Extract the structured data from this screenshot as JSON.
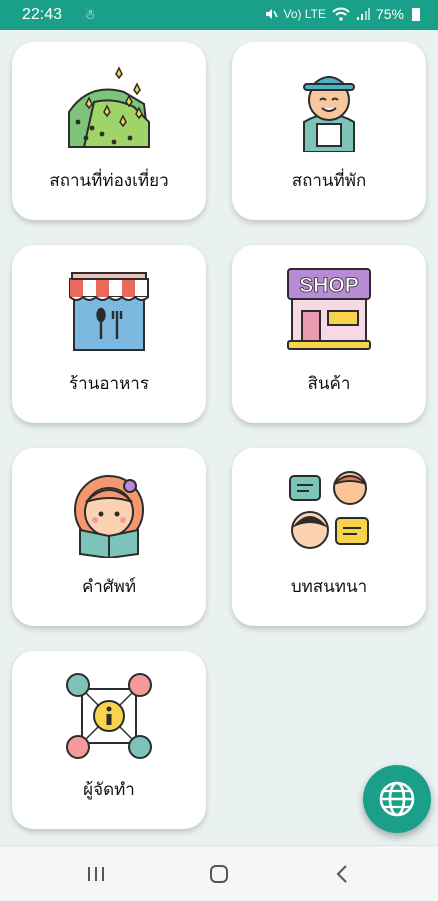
{
  "status_bar": {
    "time": "22:43",
    "notification": "☃",
    "battery_percent": "75%",
    "icons": [
      "mute-icon",
      "volte-icon",
      "wifi-icon",
      "signal-icon",
      "battery-icon"
    ],
    "volte": "Vo) LTE"
  },
  "menu": {
    "items": [
      {
        "label": "สถานที่ท่องเที่ยว",
        "icon": "tulip-field-icon"
      },
      {
        "label": "สถานที่พัก",
        "icon": "traveler-icon"
      },
      {
        "label": "ร้านอาหาร",
        "icon": "restaurant-icon"
      },
      {
        "label": "สินค้า",
        "icon": "shop-icon"
      },
      {
        "label": "คำศัพท์",
        "icon": "girl-reading-icon"
      },
      {
        "label": "บทสนทนา",
        "icon": "conversation-icon"
      },
      {
        "label": "ผู้จัดทำ",
        "icon": "info-network-icon"
      }
    ],
    "shop_sign": "SHOP"
  },
  "fab": {
    "icon": "globe-icon"
  },
  "colors": {
    "accent": "#1aa088",
    "background": "#eaf1f1"
  }
}
